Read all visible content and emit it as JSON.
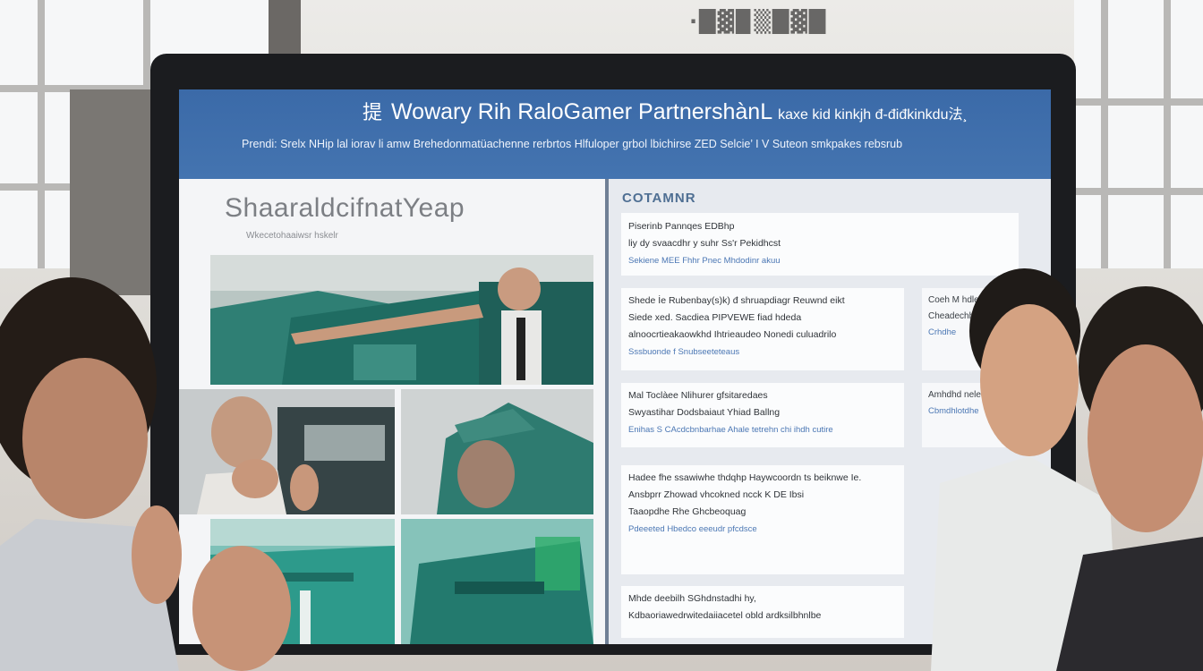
{
  "background": {
    "wall_sign": "·█▓▉▒█▓█"
  },
  "screen": {
    "header": {
      "title_mark": "提",
      "title": "Wowary Rih  RaloGamer PartnershànL",
      "title_suffix": "kaxe kid kinkjh đ-điđkinkdu法¸",
      "subtitle": "Prendi: Srelx NHip lal iorav li amw Brehedonmatüachenne rerbrtos Hlfuloper grbol lbichirse ZED Selcie’ I V Suteon smkpakes rebsrub"
    },
    "left": {
      "title": "ShaaraldcifnatYeap",
      "subtitle": "Wkecetohaaiwsr hskelr"
    },
    "right": {
      "section_title": "COTAMNR",
      "cards": [
        {
          "lines": [
            "Piserinb Pannqes EDBhp",
            "liy dy svaacdhr y suhr Ss'r Pekidhcst",
            "Sekiene  MEE Fhhr Pnec Mhdodinr akuu"
          ]
        },
        {
          "lines": [
            "Shede  İe Rubenbay(s)k)  đ shruapdiagr  Reuwnd eikt",
            "Siede xed.  Sacdiea PIPVEWE fiad hdeda",
            "alnoocrtieakaowkhd   Ihtrieaudeo Nonedi  culuadrilo",
            "Sssbuonde f Snubseeteteaus"
          ]
        },
        {
          "lines": [
            "Mal Toclàee  Nlihurer gfsitaredaes",
            "Swyastihar  Dodsbaiaut  Yhiad Ballng",
            "Enihas  S  CAcdcbnbarhae   Ahale tetrehn chi ihdh cutire"
          ]
        },
        {
          "lines": [
            "Hadee  fhe  ssawiwhe  thdqhp  Haywcoordn  ts  beiknwe Ie.",
            "Ansbprr  Zhowad  vhcokned ncck K DE Ibsi",
            "",
            "Taaopdhe  Rhe  Ghcbeoquag",
            "Pdeeeted  Hbedco eeeudr  pfcdsce"
          ]
        },
        {
          "lines": [
            "Mhde  deebilh  SGhdnstadhi hy,",
            "Kdbaoriawedrwitedaiiacetel  obld  ardksilbhnlbe"
          ]
        }
      ],
      "side_cards": [
        {
          "lines": [
            "Coeh   M hdlee",
            "Cheadechhnoge Idh",
            "",
            "Crhdhe"
          ]
        },
        {
          "lines": [
            "Amhdhd neleche",
            "",
            "Cbmdhlotdhe"
          ]
        }
      ]
    }
  }
}
